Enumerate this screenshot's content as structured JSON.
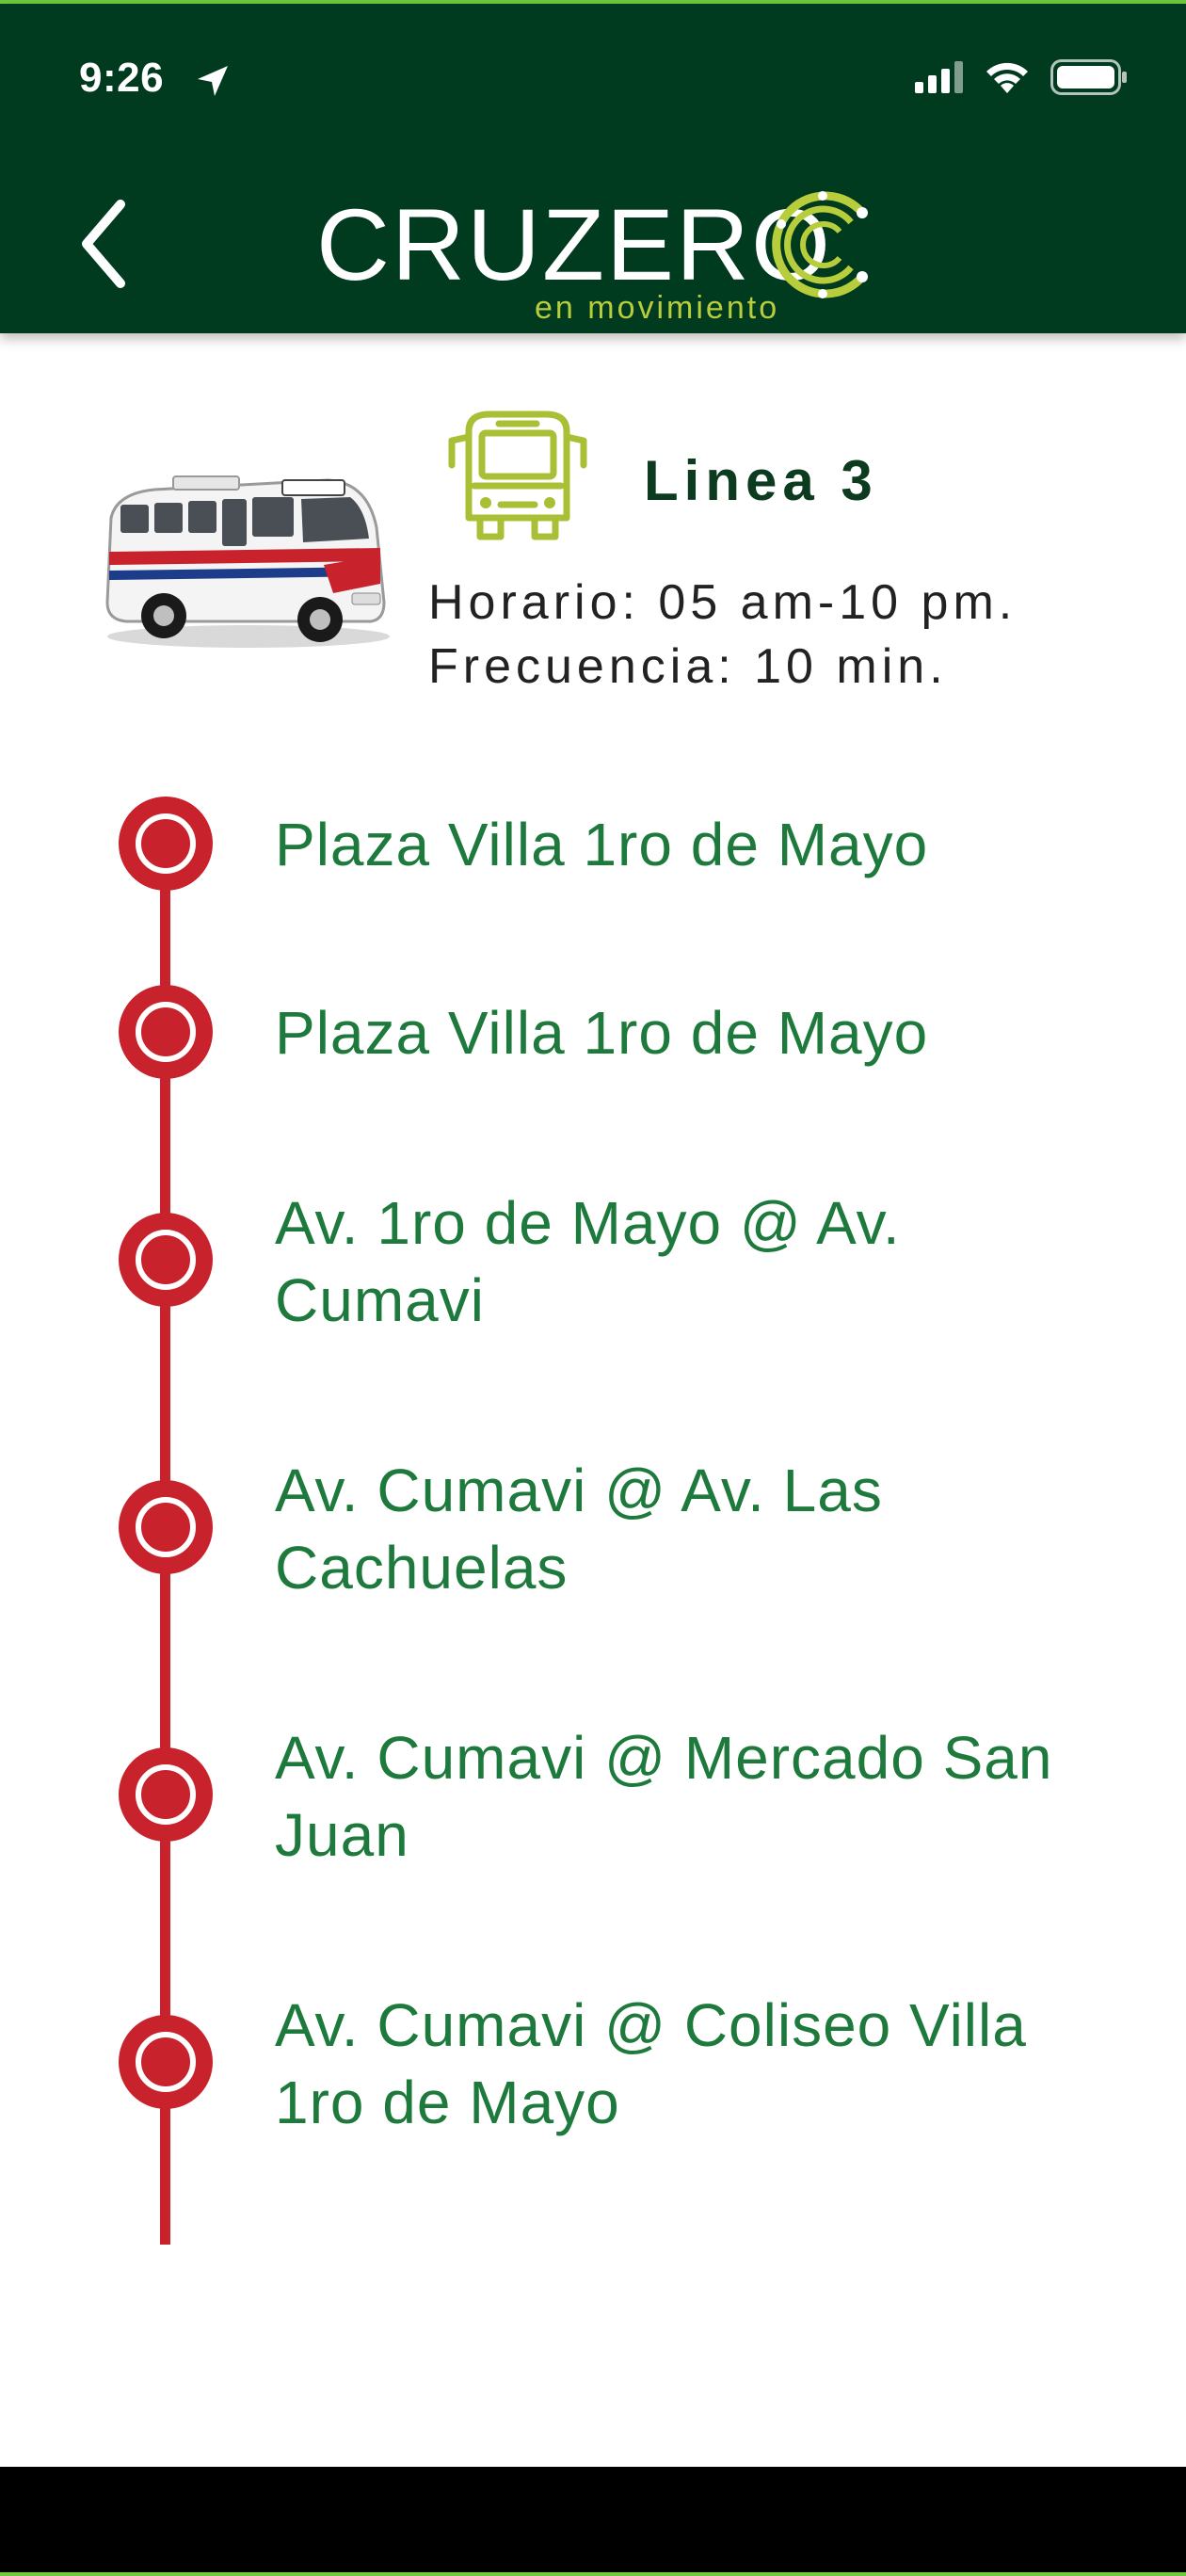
{
  "status_bar": {
    "time": "9:26",
    "icons": [
      "location-arrow-icon",
      "signal-icon",
      "wifi-icon",
      "battery-icon"
    ]
  },
  "header": {
    "back_icon": "chevron-left-icon",
    "logo_text": "CRUZERO",
    "logo_tagline": "en movimiento",
    "background": "#003b20"
  },
  "line_info": {
    "title": "Linea 3",
    "schedule": "Horario: 05 am-10 pm.",
    "frequency": "Frecuencia: 10 min.",
    "bus_icon": "bus-icon",
    "bus_icon_color": "#a9bf35"
  },
  "route": {
    "color": "#c8222c",
    "text_color": "#1d7a3c",
    "stops": [
      {
        "name": "Plaza Villa 1ro de Mayo"
      },
      {
        "name": "Plaza Villa 1ro de Mayo"
      },
      {
        "name": "Av. 1ro de Mayo @ Av. Cumavi"
      },
      {
        "name": "Av. Cumavi @ Av. Las Cachuelas"
      },
      {
        "name": "Av. Cumavi @ Mercado San Juan"
      },
      {
        "name": "Av. Cumavi @ Coliseo Villa 1ro de Mayo"
      }
    ]
  }
}
